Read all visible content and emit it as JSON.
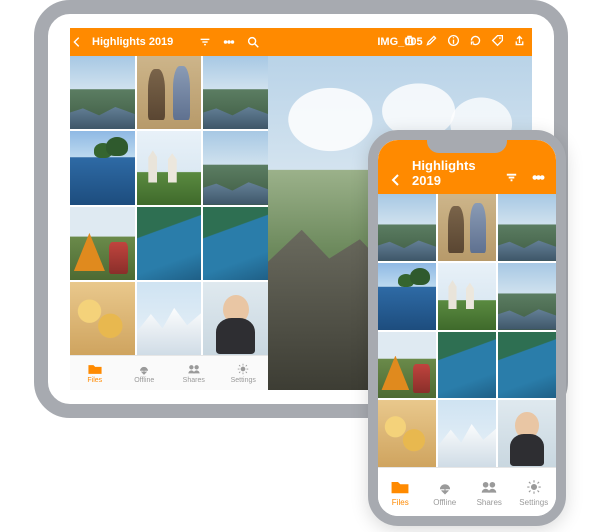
{
  "accent": "#ff8a00",
  "tablet": {
    "header": {
      "title": "Highlights 2019",
      "icons": [
        "sort-icon",
        "more-icon",
        "search-icon"
      ]
    },
    "viewer": {
      "filename": "IMG_005",
      "icons": [
        "trash-icon",
        "edit-icon",
        "info-icon",
        "refresh-icon",
        "tag-icon",
        "share-icon"
      ]
    },
    "tabs": {
      "files": "Files",
      "offline": "Offline",
      "shares": "Shares",
      "settings": "Settings"
    }
  },
  "phone": {
    "header": {
      "title": "Highlights 2019",
      "icons": [
        "sort-icon",
        "more-icon"
      ]
    },
    "tabs": {
      "files": "Files",
      "offline": "Offline",
      "shares": "Shares",
      "settings": "Settings"
    }
  }
}
